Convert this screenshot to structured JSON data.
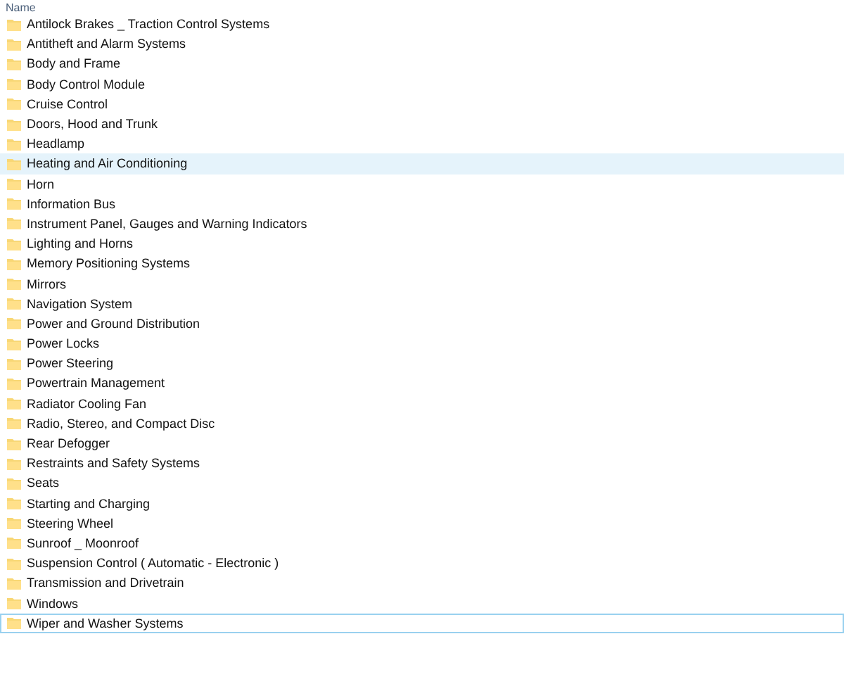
{
  "column_header": "Name",
  "items": [
    {
      "name": "Antilock Brakes _ Traction Control Systems",
      "hovered": false,
      "focused": false
    },
    {
      "name": "Antitheft and Alarm Systems",
      "hovered": false,
      "focused": false
    },
    {
      "name": "Body and Frame",
      "hovered": false,
      "focused": false
    },
    {
      "name": "Body Control Module",
      "hovered": false,
      "focused": false
    },
    {
      "name": "Cruise Control",
      "hovered": false,
      "focused": false
    },
    {
      "name": "Doors, Hood and Trunk",
      "hovered": false,
      "focused": false
    },
    {
      "name": "Headlamp",
      "hovered": false,
      "focused": false
    },
    {
      "name": "Heating and Air Conditioning",
      "hovered": true,
      "focused": false
    },
    {
      "name": "Horn",
      "hovered": false,
      "focused": false
    },
    {
      "name": "Information Bus",
      "hovered": false,
      "focused": false
    },
    {
      "name": "Instrument Panel, Gauges and Warning Indicators",
      "hovered": false,
      "focused": false
    },
    {
      "name": "Lighting and Horns",
      "hovered": false,
      "focused": false
    },
    {
      "name": "Memory Positioning Systems",
      "hovered": false,
      "focused": false
    },
    {
      "name": "Mirrors",
      "hovered": false,
      "focused": false
    },
    {
      "name": "Navigation System",
      "hovered": false,
      "focused": false
    },
    {
      "name": "Power and Ground Distribution",
      "hovered": false,
      "focused": false
    },
    {
      "name": "Power Locks",
      "hovered": false,
      "focused": false
    },
    {
      "name": "Power Steering",
      "hovered": false,
      "focused": false
    },
    {
      "name": "Powertrain Management",
      "hovered": false,
      "focused": false
    },
    {
      "name": "Radiator Cooling Fan",
      "hovered": false,
      "focused": false
    },
    {
      "name": "Radio, Stereo, and Compact Disc",
      "hovered": false,
      "focused": false
    },
    {
      "name": "Rear Defogger",
      "hovered": false,
      "focused": false
    },
    {
      "name": "Restraints and Safety Systems",
      "hovered": false,
      "focused": false
    },
    {
      "name": "Seats",
      "hovered": false,
      "focused": false
    },
    {
      "name": "Starting and Charging",
      "hovered": false,
      "focused": false
    },
    {
      "name": "Steering Wheel",
      "hovered": false,
      "focused": false
    },
    {
      "name": "Sunroof _ Moonroof",
      "hovered": false,
      "focused": false
    },
    {
      "name": "Suspension Control ( Automatic - Electronic )",
      "hovered": false,
      "focused": false
    },
    {
      "name": "Transmission and Drivetrain",
      "hovered": false,
      "focused": false
    },
    {
      "name": "Windows",
      "hovered": false,
      "focused": false
    },
    {
      "name": "Wiper and Washer Systems",
      "hovered": false,
      "focused": true
    }
  ]
}
